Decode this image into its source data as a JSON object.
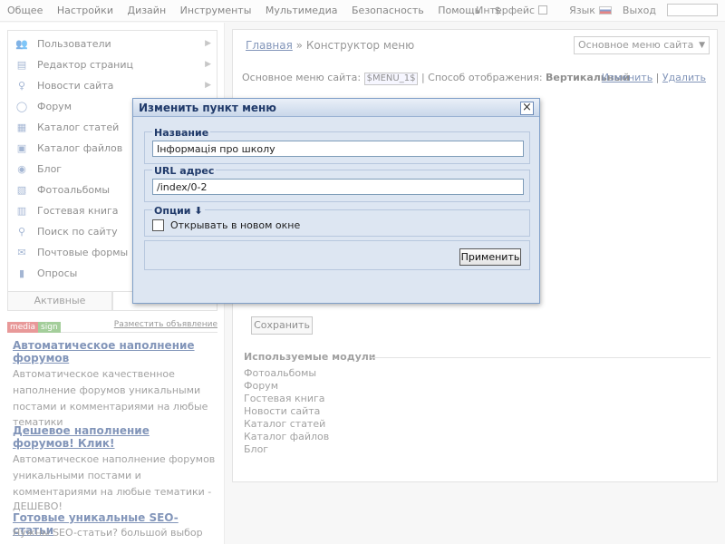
{
  "topbar": {
    "menu": [
      "Общее",
      "Настройки",
      "Дизайн",
      "Инструменты",
      "Мультимедиа",
      "Безопасность",
      "Помощь",
      "$"
    ],
    "interface_label": "Интерфейс",
    "lang_label": "Язык",
    "logout_label": "Выход"
  },
  "sidebar": {
    "items": [
      {
        "label": "Пользователи",
        "icon": "users-icon"
      },
      {
        "label": "Редактор страниц",
        "icon": "page-editor-icon"
      },
      {
        "label": "Новости сайта",
        "icon": "news-icon"
      },
      {
        "label": "Форум",
        "icon": "forum-icon"
      },
      {
        "label": "Каталог статей",
        "icon": "articles-icon"
      },
      {
        "label": "Каталог файлов",
        "icon": "files-icon"
      },
      {
        "label": "Блог",
        "icon": "blog-icon"
      },
      {
        "label": "Фотоальбомы",
        "icon": "photo-icon"
      },
      {
        "label": "Гостевая книга",
        "icon": "guestbook-icon"
      },
      {
        "label": "Поиск по сайту",
        "icon": "search-icon"
      },
      {
        "label": "Почтовые формы",
        "icon": "mail-icon"
      },
      {
        "label": "Опросы",
        "icon": "polls-icon"
      }
    ],
    "tab_active": "Активные",
    "ads": {
      "badge1": "media",
      "badge2": "sign",
      "link": "Разместить объявление",
      "items": [
        {
          "title": "Автоматическое наполнение форумов",
          "text": [
            "Автоматическое качественное",
            "наполнение форумов уникальными",
            "постами и комментариями на любые",
            "тематики"
          ]
        },
        {
          "title": "Дешевое наполнение форумов! Клик!",
          "text": [
            "Автоматическое наполнение форумов",
            "уникальными постами и",
            "комментариями на любые тематики -",
            "ДЕШЕВО!"
          ]
        },
        {
          "title": "Готовые уникальные SEO-статьи",
          "text": [
            "Нужны SEO-статьи? большой выбор"
          ]
        }
      ]
    }
  },
  "main": {
    "breadcrumb_home": "Главная",
    "breadcrumb_sep": " » ",
    "breadcrumb_current": "Конструктор меню",
    "menu_select": "Основное меню сайта",
    "row_label": "Основное меню сайта:",
    "code": "$MENU_1$",
    "mode_label": "| Способ отображения:",
    "mode_value": "Вертикальный",
    "edit_link": "Изменить",
    "delete_link": "Удалить",
    "save_label": "Сохранить",
    "used_title": "Используемые модули",
    "used_modules": [
      "Фотоальбомы",
      "Форум",
      "Гостевая книга",
      "Новости сайта",
      "Каталог статей",
      "Каталог файлов",
      "Блог"
    ]
  },
  "modal": {
    "title": "Изменить пункт меню",
    "name_legend": "Название",
    "name_value": "Інформація про школу",
    "url_legend": "URL адрес",
    "url_value": "/index/0-2",
    "options_legend": "Опции ⬇",
    "new_window_label": "Открывать в новом окне",
    "apply_label": "Применить"
  }
}
